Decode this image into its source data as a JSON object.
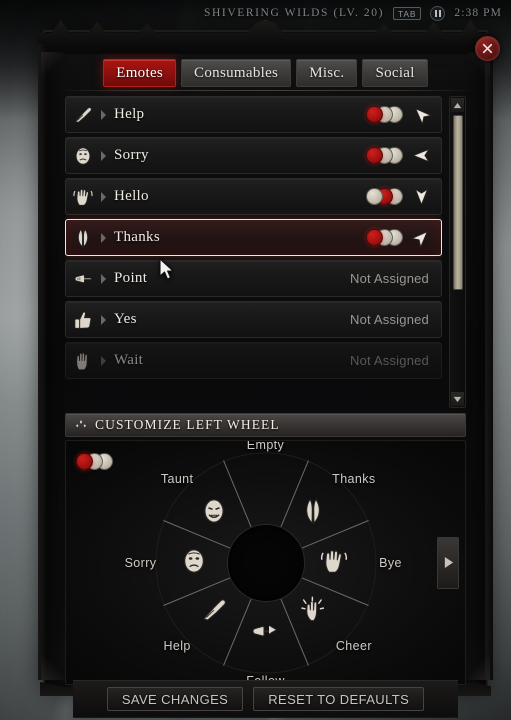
{
  "topbar": {
    "zone": "SHIVERING WILDS (LV. 20)",
    "tab_key": "TAB",
    "pause_icon": "pause-icon",
    "clock": "2:38 PM"
  },
  "panel": {
    "close_icon": "close-icon",
    "tabs": [
      {
        "label": "Emotes",
        "active": true
      },
      {
        "label": "Consumables",
        "active": false
      },
      {
        "label": "Misc.",
        "active": false
      },
      {
        "label": "Social",
        "active": false
      }
    ]
  },
  "list": {
    "unassigned_label": "Not Assigned",
    "rows": [
      {
        "label": "Help",
        "icon": "hand-help-icon",
        "assigned": true,
        "slot": 1,
        "direction": "up-left",
        "selected": false,
        "faded": false
      },
      {
        "label": "Sorry",
        "icon": "face-sorry-icon",
        "assigned": true,
        "slot": 1,
        "direction": "left",
        "selected": false,
        "faded": false
      },
      {
        "label": "Hello",
        "icon": "hand-wave-icon",
        "assigned": true,
        "slot": 2,
        "direction": "down",
        "selected": false,
        "faded": false
      },
      {
        "label": "Thanks",
        "icon": "praying-hands-icon",
        "assigned": true,
        "slot": 1,
        "direction": "up-right",
        "selected": true,
        "faded": false
      },
      {
        "label": "Point",
        "icon": "hand-point-icon",
        "assigned": false,
        "slot": 0,
        "direction": "",
        "selected": false,
        "faded": false
      },
      {
        "label": "Yes",
        "icon": "thumbs-up-icon",
        "assigned": false,
        "slot": 0,
        "direction": "",
        "selected": false,
        "faded": false
      },
      {
        "label": "Wait",
        "icon": "open-palm-icon",
        "assigned": false,
        "slot": 0,
        "direction": "",
        "selected": false,
        "faded": true
      }
    ],
    "scrollbar": {
      "up_icon": "caret-up-icon",
      "down_icon": "caret-down-icon"
    }
  },
  "wheel_section": {
    "header_icon": "diamond-cluster-icon",
    "header_title": "CUSTOMIZE LEFT WHEEL",
    "active_wheel_slot": 1,
    "wheel_slots_total": 3,
    "next_wheel_icon": "caret-right-icon",
    "hub_label": "",
    "segments": [
      {
        "label": "Empty",
        "angle": 90,
        "icon": "none-icon"
      },
      {
        "label": "Thanks",
        "angle": 45,
        "icon": "praying-hands-icon"
      },
      {
        "label": "Bye",
        "angle": 0,
        "icon": "hand-wave-icon"
      },
      {
        "label": "Cheer",
        "angle": -45,
        "icon": "clapping-hands-icon"
      },
      {
        "label": "Follow",
        "angle": -90,
        "icon": "hand-point-right-icon"
      },
      {
        "label": "Help",
        "angle": -135,
        "icon": "hand-help-icon"
      },
      {
        "label": "Sorry",
        "angle": 180,
        "icon": "face-sorry-icon"
      },
      {
        "label": "Taunt",
        "angle": 135,
        "icon": "face-taunt-icon"
      }
    ]
  },
  "footer": {
    "save_label": "SAVE CHANGES",
    "reset_label": "RESET TO DEFAULTS"
  },
  "colors": {
    "accent_red": "#a81512",
    "indicator_red": "#cf1f1c",
    "indicator_pale": "#e8e2d6",
    "panel_bg": "#0e0e0f",
    "text": "#efeae4"
  }
}
